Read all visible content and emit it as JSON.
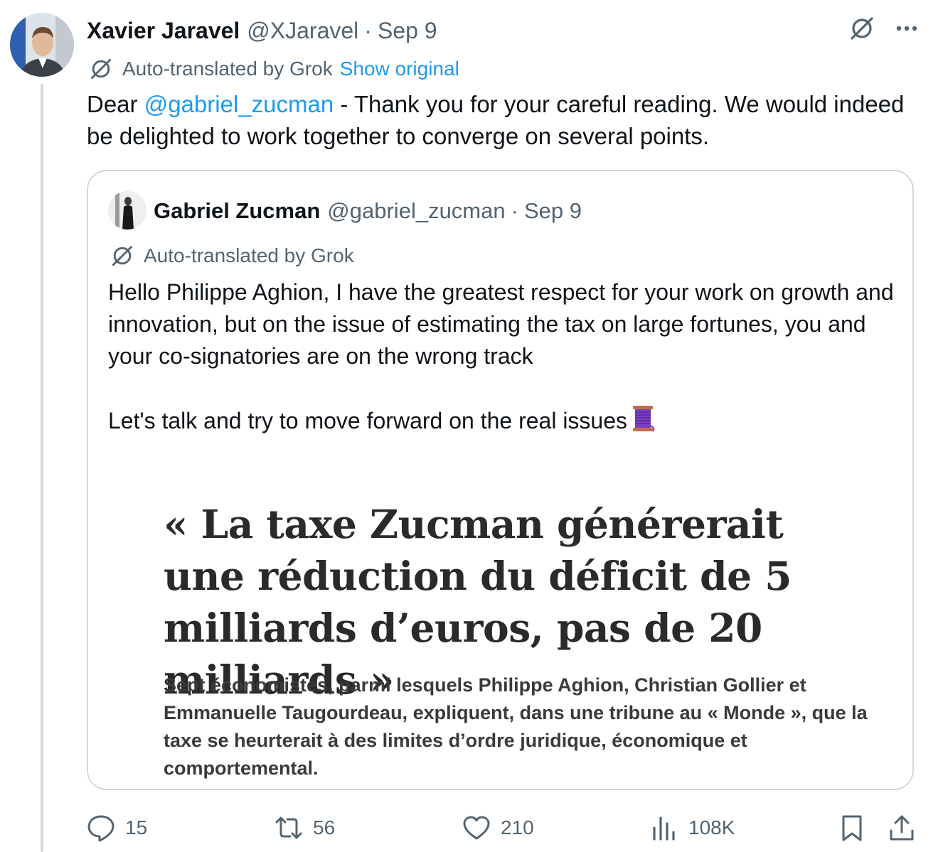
{
  "author": {
    "name": "Xavier Jaravel",
    "handle": "@XJaravel",
    "date": "Sep 9",
    "separator": "·"
  },
  "translation": {
    "label": "Auto-translated by Grok",
    "show_original": "Show original"
  },
  "tweet": {
    "prefix": "Dear ",
    "mention": "@gabriel_zucman",
    "body": "  - Thank you for your careful reading. We would indeed be delighted to work together to converge on several points."
  },
  "quote": {
    "name": "Gabriel Zucman",
    "handle": "@gabriel_zucman",
    "date": "Sep 9",
    "separator": "·",
    "translation_label": "Auto-translated by Grok",
    "paragraph1": "Hello Philippe Aghion, I have the greatest respect for your work on growth and innovation, but on the issue of estimating the tax on large fortunes, you and your co-signatories are on the wrong track",
    "paragraph2": "Let's talk and try to move forward on the real issues",
    "emoji": "spool-of-thread",
    "article": {
      "headline": "« La taxe Zucman générerait une réduction du déficit de 5 milliards d’euros, pas de 20 milliards »",
      "standfirst": "Sept économistes, parmi lesquels Philippe Aghion, Christian Gollier et Emmanuelle Taugourdeau, expliquent, dans une tribune au « Monde », que la taxe se heurterait à des limites d’ordre juridique, économique et comportemental."
    }
  },
  "actions": {
    "replies": "15",
    "reposts": "56",
    "likes": "210",
    "views": "108K"
  },
  "icons": {
    "grok": "grok-icon",
    "more": "more-icon",
    "reply": "reply-icon",
    "repost": "repost-icon",
    "like": "heart-icon",
    "views": "views-icon",
    "bookmark": "bookmark-icon",
    "share": "share-icon"
  },
  "colors": {
    "link": "#1d9bf0",
    "secondary_text": "#536471",
    "primary_text": "#0f1419",
    "border": "#cfd9de"
  }
}
